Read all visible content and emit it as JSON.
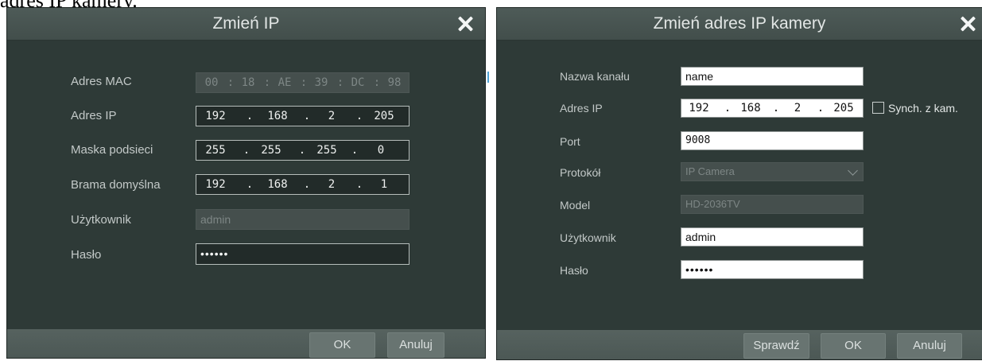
{
  "document_fragment": "adres IP kamery.",
  "left_dialog": {
    "title": "Zmień IP",
    "close_icon": "close-icon",
    "fields": {
      "mac": {
        "label": "Adres MAC",
        "octets": [
          "00",
          "18",
          "AE",
          "39",
          "DC",
          "98"
        ],
        "separator": ":"
      },
      "ip": {
        "label": "Adres IP",
        "octets": [
          "192",
          "168",
          "2",
          "205"
        ],
        "separator": "."
      },
      "mask": {
        "label": "Maska podsieci",
        "octets": [
          "255",
          "255",
          "255",
          "0"
        ],
        "separator": "."
      },
      "gateway": {
        "label": "Brama domyślna",
        "octets": [
          "192",
          "168",
          "2",
          "1"
        ],
        "separator": "."
      },
      "user": {
        "label": "Użytkownik",
        "value": "admin"
      },
      "password": {
        "label": "Hasło",
        "value": "••••••"
      }
    },
    "buttons": {
      "ok": "OK",
      "cancel": "Anuluj"
    }
  },
  "right_dialog": {
    "title": "Zmień adres IP kamery",
    "close_icon": "close-icon",
    "fields": {
      "channel_name": {
        "label": "Nazwa kanału",
        "value": "name"
      },
      "ip": {
        "label": "Adres IP",
        "octets": [
          "192",
          "168",
          "2",
          "205"
        ],
        "separator": "."
      },
      "sync": {
        "label": "Synch. z kam.",
        "checked": false
      },
      "port": {
        "label": "Port",
        "value": "9008"
      },
      "protocol": {
        "label": "Protokół",
        "value": "IP Camera"
      },
      "model": {
        "label": "Model",
        "value": "HD-2036TV"
      },
      "user": {
        "label": "Użytkownik",
        "value": "admin"
      },
      "password": {
        "label": "Hasło",
        "value": "••••••"
      }
    },
    "buttons": {
      "check": "Sprawdź",
      "ok": "OK",
      "cancel": "Anuluj"
    }
  },
  "colors": {
    "dialog_bg": "#2e3a37",
    "titlebar": "#4a5653",
    "footer": "#525e5b",
    "button": "#687471",
    "accent": "#4ea3d6"
  }
}
